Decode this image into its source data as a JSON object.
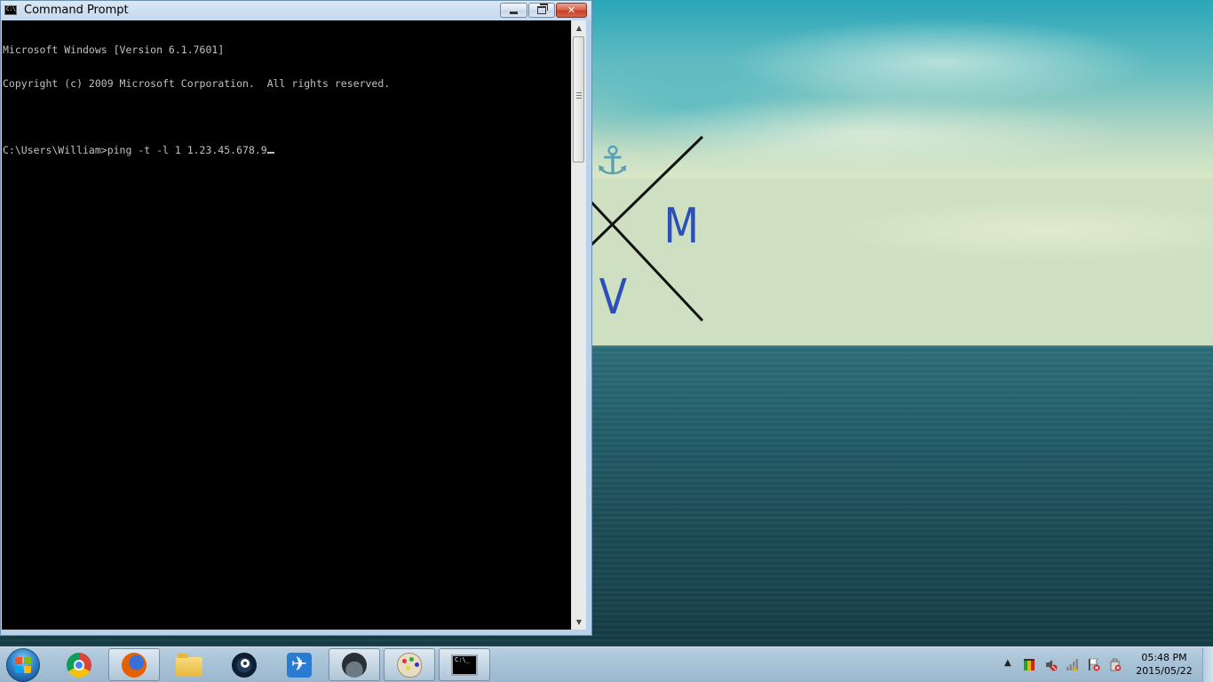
{
  "window": {
    "title": "Command Prompt",
    "icon": "cmd-icon"
  },
  "console": {
    "lines": [
      "Microsoft Windows [Version 6.1.7601]",
      "Copyright (c) 2009 Microsoft Corporation.  All rights reserved.",
      "",
      "C:\\Users\\William>ping -t -l 1 1.23.45.678.9"
    ]
  },
  "wallpaper": {
    "letters": [
      "M",
      "V"
    ],
    "anchor_icon": "anchor-icon",
    "letter_color": "#2c4fb8"
  },
  "taskbar": {
    "pinned": [
      {
        "name": "chrome",
        "icon": "chrome-icon"
      },
      {
        "name": "firefox",
        "icon": "firefox-icon"
      },
      {
        "name": "explorer",
        "icon": "folder-icon"
      },
      {
        "name": "steam",
        "icon": "steam-icon"
      },
      {
        "name": "flight",
        "icon": "plane-icon"
      },
      {
        "name": "spy",
        "icon": "spy-icon"
      },
      {
        "name": "paint",
        "icon": "paint-icon"
      },
      {
        "name": "command-prompt",
        "icon": "cmd-icon"
      }
    ],
    "clock": {
      "time": "05:48 PM",
      "date": "2015/05/22"
    },
    "tray_icons": [
      "action-center-icon",
      "volume-muted-icon",
      "network-icon",
      "flag-error-icon",
      "usb-icon"
    ]
  },
  "colors": {
    "taskbar": "#a9c3d7",
    "console_bg": "#000000",
    "console_text": "#c0c0c0",
    "close_button": "#c7402a"
  }
}
